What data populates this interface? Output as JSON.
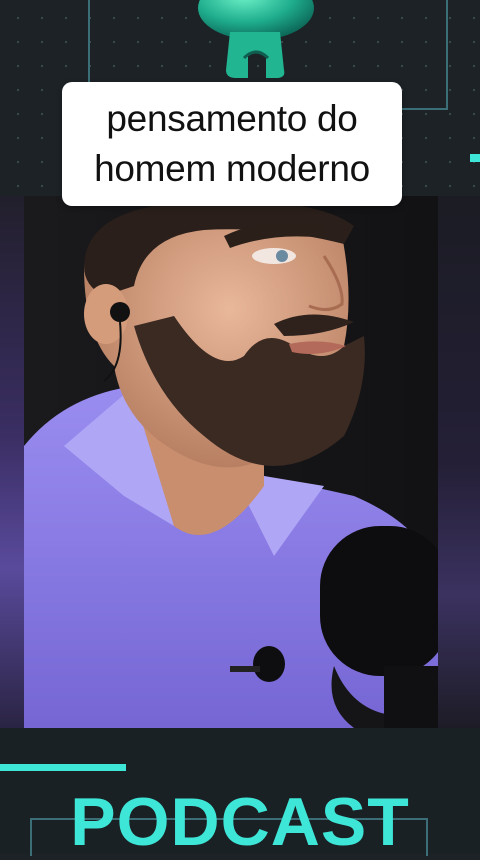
{
  "caption": {
    "line1": "pensamento do",
    "line2": "homem moderno"
  },
  "footer": {
    "title": "PODCAST"
  },
  "colors": {
    "background": "#1c2226",
    "accent": "#3ee6d8",
    "frame": "#3c6e77",
    "caption_bg": "#ffffff",
    "shirt": "#8a7ae6"
  },
  "icons": {
    "mic_clip": "microphone-clip-icon",
    "studio_mic": "studio-microphone-icon",
    "earphone": "earphone-icon",
    "lavalier": "lavalier-mic-icon"
  }
}
